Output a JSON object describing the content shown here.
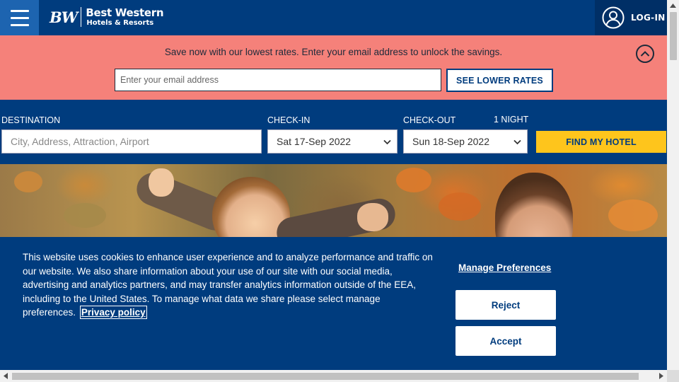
{
  "header": {
    "logo": {
      "mark": "BW",
      "line1": "Best Western",
      "line2": "Hotels & Resorts"
    },
    "menu_icon": "hamburger-menu-icon",
    "login_label": "LOG-IN",
    "login_icon": "user-circle-icon"
  },
  "promo": {
    "message": "Save now with our lowest rates. Enter your email address to unlock the savings.",
    "email_placeholder": "Enter your email address",
    "button_label": "SEE LOWER RATES",
    "collapse_icon": "chevron-up-circle-icon"
  },
  "search": {
    "destination_label": "DESTINATION",
    "destination_placeholder": "City, Address, Attraction, Airport",
    "checkin_label": "CHECK-IN",
    "checkin_value": "Sat 17-Sep 2022",
    "checkout_label": "CHECK-OUT",
    "checkout_value": "Sun 18-Sep 2022",
    "nights_label": "1 NIGHT",
    "find_button": "FIND MY HOTEL"
  },
  "cookie": {
    "text": "This website uses cookies to enhance user experience and to analyze performance and traffic on our website. We also share information about your use of our site with our social media, advertising and analytics partners, and may transfer analytics information outside of the EEA, including to the United States. To manage what data we share please select manage preferences.",
    "privacy_link": "Privacy policy",
    "manage_link": "Manage Preferences",
    "reject_label": "Reject",
    "accept_label": "Accept"
  },
  "colors": {
    "brand_blue": "#003c7e",
    "promo_salmon": "#f5817a",
    "find_yellow": "#fec51c"
  }
}
